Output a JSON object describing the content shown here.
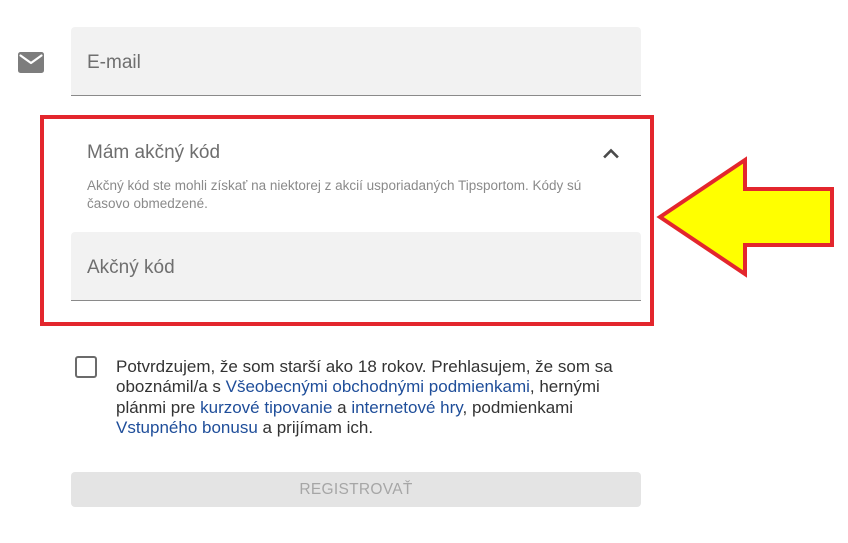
{
  "email": {
    "icon": "mail-icon",
    "placeholder": "E-mail"
  },
  "promo": {
    "title": "Mám akčný kód",
    "toggle_icon": "chevron-up-icon",
    "description": "Akčný kód ste mohli získať na niektorej z akcií usporiadaných Tipsportom. Kódy sú časovo obmedzené.",
    "placeholder": "Akčný kód"
  },
  "consent": {
    "text_1": "Potvrdzujem, že som starší ako 18 rokov. Prehlasujem, že som sa oboznámil/a s ",
    "link_terms": "Všeobecnými obchodnými podmienkami",
    "text_2": ", hernými plánmi pre ",
    "link_betting": "kurzové tipovanie",
    "text_3": " a ",
    "link_games": "internetové hry",
    "text_4": ", podmienkami ",
    "link_bonus": "Vstupného bonusu",
    "text_5": " a prijímam ich.",
    "checked": false
  },
  "register_button": {
    "label": "REGISTROVAŤ",
    "enabled": false
  },
  "annotation": {
    "highlight_color": "#e3262d",
    "arrow_color": "#ffff00",
    "arrow_icon": "arrow-left-icon"
  },
  "colors": {
    "field_background": "#f2f2f2",
    "link": "#1f4e9a",
    "button_disabled": "#e4e4e4"
  }
}
